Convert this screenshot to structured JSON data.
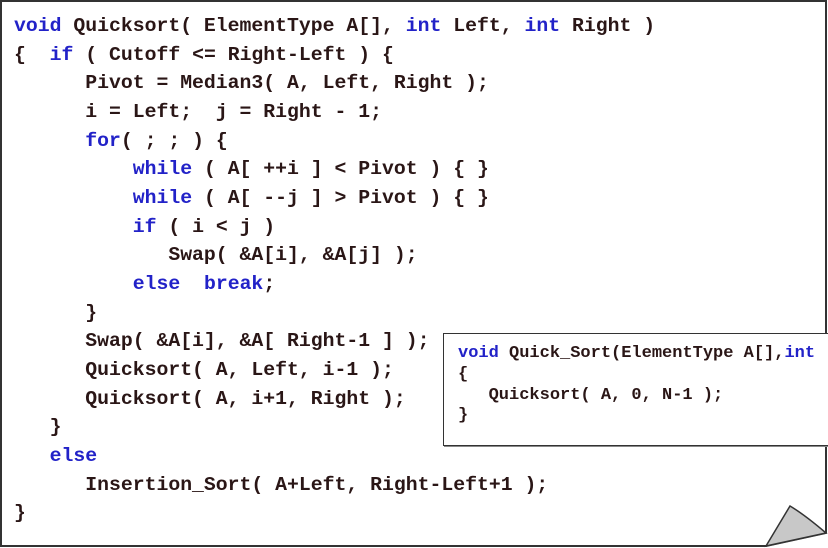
{
  "colors": {
    "text": "#2a1616",
    "keyword": "#2222c8",
    "corner_fold": "#c8c8c8"
  },
  "main_code": [
    [
      {
        "t": "void",
        "k": 1
      },
      {
        "t": " Quicksort( ElementType A[], "
      },
      {
        "t": "int",
        "k": 1
      },
      {
        "t": " Left, "
      },
      {
        "t": "int",
        "k": 1
      },
      {
        "t": " Right )"
      }
    ],
    [
      {
        "t": "{  "
      },
      {
        "t": "if",
        "k": 1
      },
      {
        "t": " ( Cutoff <= Right-Left ) {"
      }
    ],
    [
      {
        "t": "      Pivot = Median3( A, Left, Right );"
      }
    ],
    [
      {
        "t": "      i = Left;  j = Right - 1;"
      }
    ],
    [
      {
        "t": "      "
      },
      {
        "t": "for",
        "k": 1
      },
      {
        "t": "( ; ; ) {"
      }
    ],
    [
      {
        "t": "          "
      },
      {
        "t": "while",
        "k": 1
      },
      {
        "t": " ( A[ ++i ] < Pivot ) { }"
      }
    ],
    [
      {
        "t": "          "
      },
      {
        "t": "while",
        "k": 1
      },
      {
        "t": " ( A[ --j ] > Pivot ) { }"
      }
    ],
    [
      {
        "t": "          "
      },
      {
        "t": "if",
        "k": 1
      },
      {
        "t": " ( i < j )"
      }
    ],
    [
      {
        "t": "             Swap( &A[i], &A[j] );"
      }
    ],
    [
      {
        "t": "          "
      },
      {
        "t": "else",
        "k": 1
      },
      {
        "t": "  "
      },
      {
        "t": "break",
        "k": 1
      },
      {
        "t": ";"
      }
    ],
    [
      {
        "t": "      }"
      }
    ],
    [
      {
        "t": "      Swap( &A[i], &A[ Right-1 ] );"
      }
    ],
    [
      {
        "t": "      Quicksort( A, Left, i-1 );"
      }
    ],
    [
      {
        "t": "      Quicksort( A, i+1, Right );"
      }
    ],
    [
      {
        "t": "   }"
      }
    ],
    [
      {
        "t": "   "
      },
      {
        "t": "else",
        "k": 1
      }
    ],
    [
      {
        "t": "      Insertion_Sort( A+Left, Right-Left+1 );"
      }
    ],
    [
      {
        "t": "}"
      }
    ]
  ],
  "driver_code": [
    [
      {
        "t": "void",
        "k": 1
      },
      {
        "t": " Quick_Sort(ElementType A[],"
      },
      {
        "t": "int",
        "k": 1
      }
    ],
    [
      {
        "t": "{"
      }
    ],
    [
      {
        "t": "   Quicksort( A, 0, N-1 );"
      }
    ],
    [
      {
        "t": "}"
      }
    ]
  ]
}
